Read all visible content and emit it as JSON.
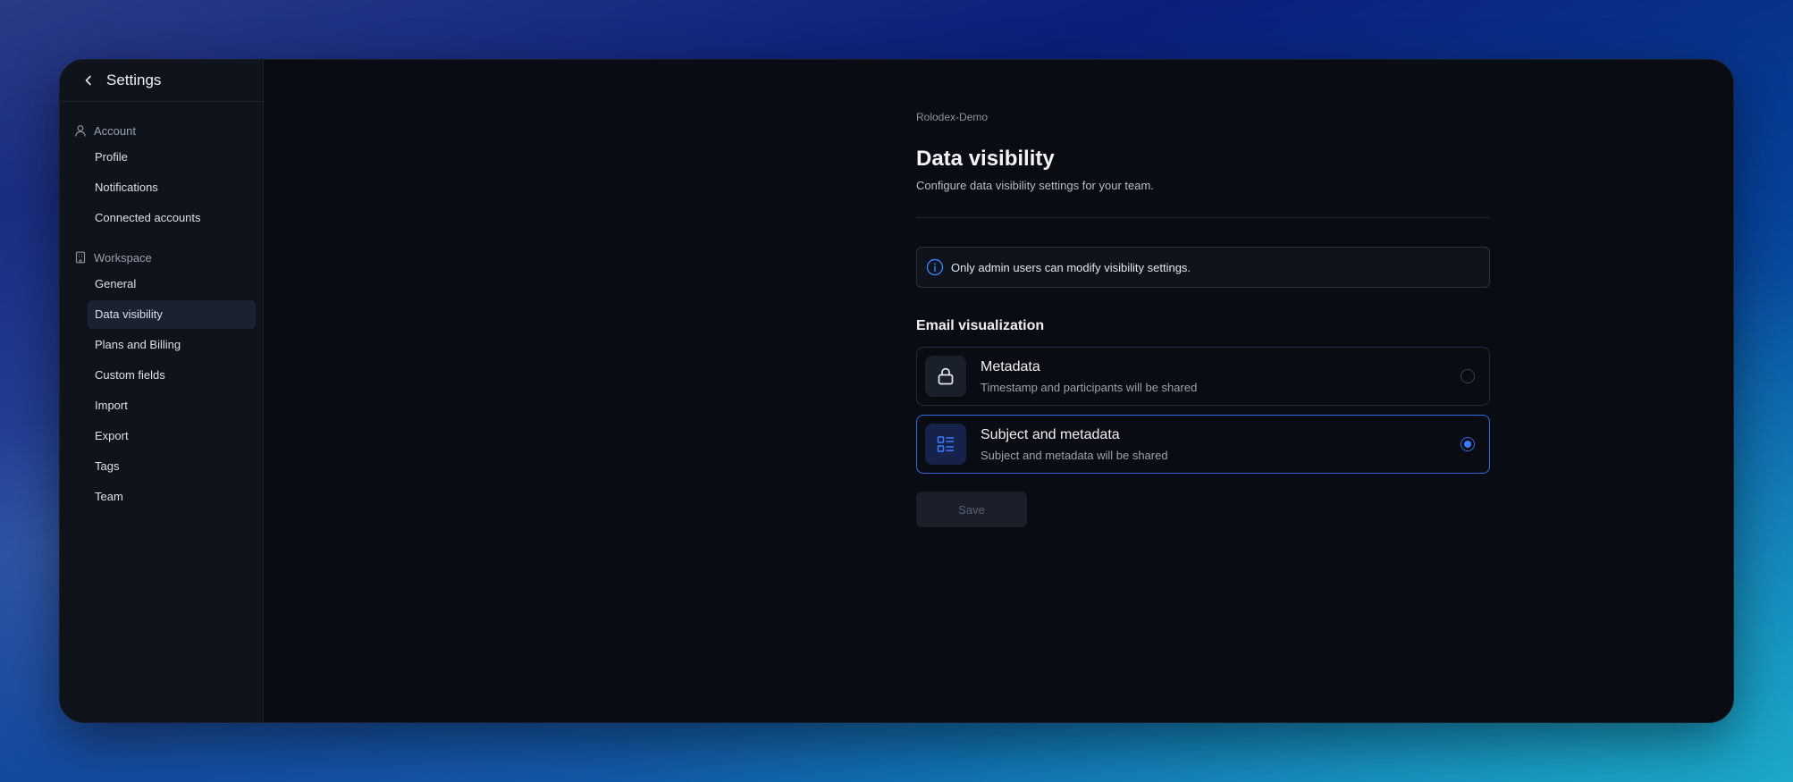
{
  "sidebar": {
    "title": "Settings",
    "sections": [
      {
        "label": "Account",
        "icon": "user-icon",
        "items": [
          "Profile",
          "Notifications",
          "Connected accounts"
        ]
      },
      {
        "label": "Workspace",
        "icon": "building-icon",
        "items": [
          "General",
          "Data visibility",
          "Plans and Billing",
          "Custom fields",
          "Import",
          "Export",
          "Tags",
          "Team"
        ]
      }
    ],
    "active_item": "Data visibility"
  },
  "main": {
    "breadcrumb": "Rolodex-Demo",
    "title": "Data visibility",
    "subtitle": "Configure data visibility settings for your team.",
    "notice": "Only admin users can modify visibility settings.",
    "section_title": "Email visualization",
    "options": [
      {
        "title": "Metadata",
        "description": "Timestamp and participants will be shared",
        "icon": "lock-icon",
        "selected": false
      },
      {
        "title": "Subject and metadata",
        "description": "Subject and metadata will be shared",
        "icon": "list-icon",
        "selected": true
      }
    ],
    "save_label": "Save"
  },
  "colors": {
    "accent": "#2f6ae6",
    "background": "#090c12",
    "sidebar": "#0f131b"
  }
}
